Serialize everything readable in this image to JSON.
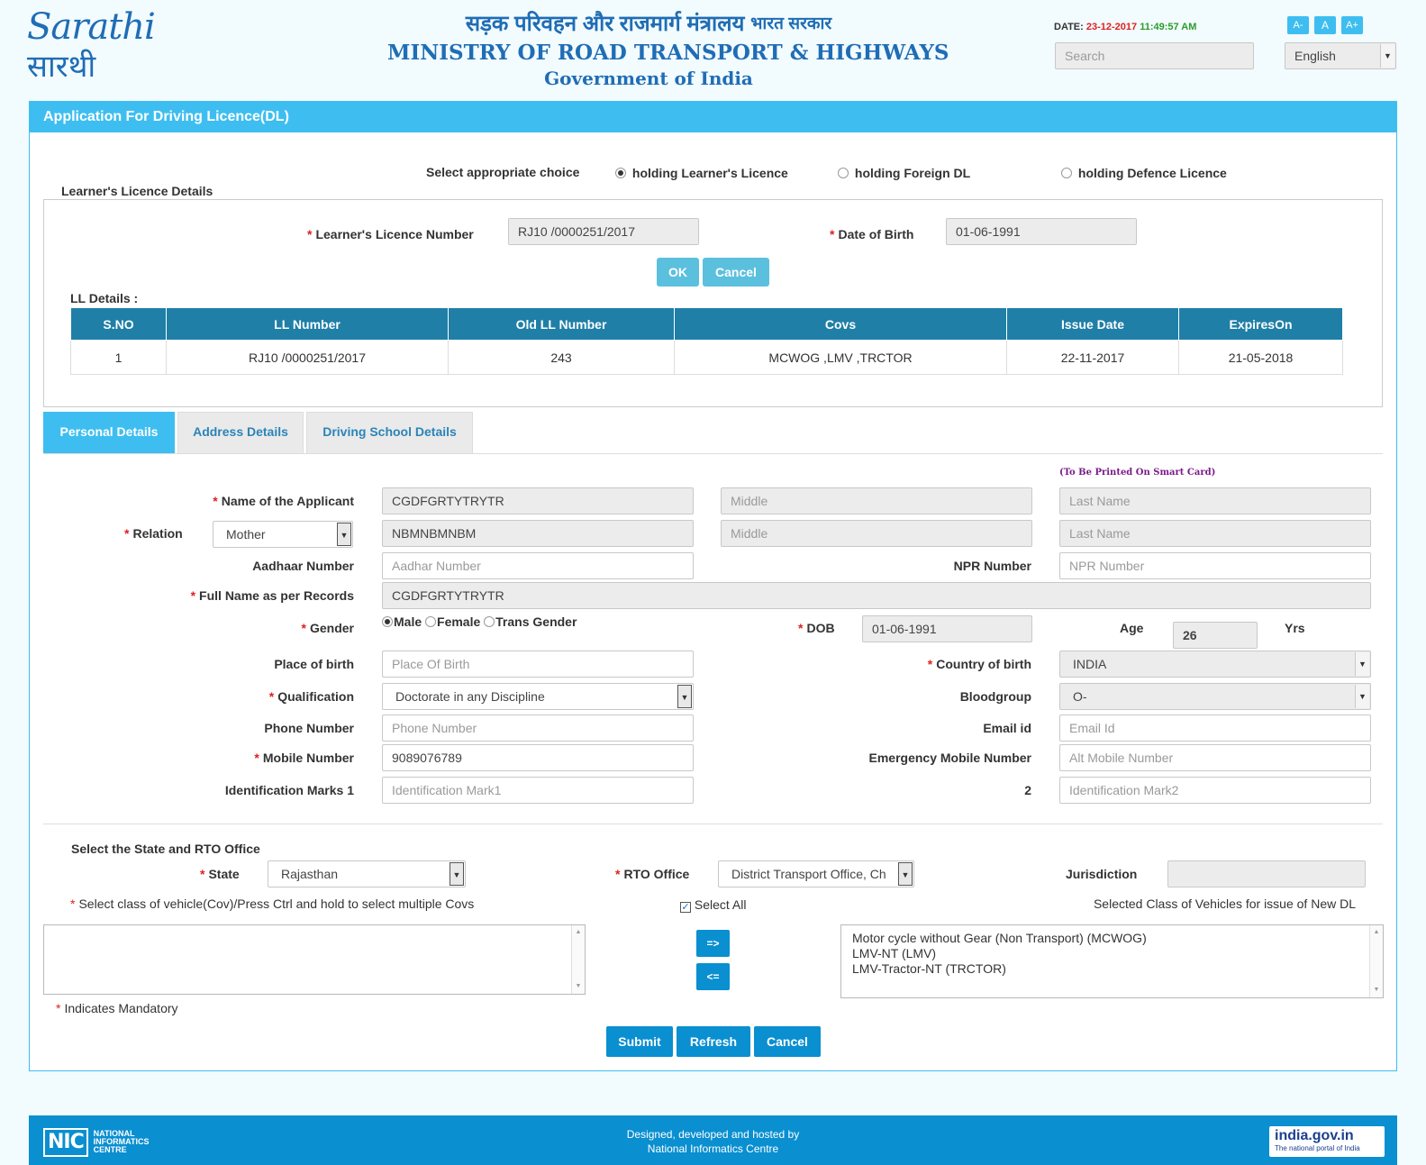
{
  "header": {
    "logo_en": "Sarathi",
    "logo_hi": "सारथी",
    "ministry_hindi": "सड़क परिवहन और राजमार्ग मंत्रालय",
    "gov_hindi": "भारत सरकार",
    "ministry": "MINISTRY OF ROAD TRANSPORT & HIGHWAYS",
    "government": "Government of India",
    "date_label": "DATE:",
    "date": "23-12-2017",
    "time": "11:49:57 AM",
    "font_small": "A-",
    "font_normal": "A",
    "font_large": "A+",
    "search_placeholder": "Search",
    "language": "English"
  },
  "panel": {
    "title": "Application For Driving Licence(DL)"
  },
  "choice": {
    "label": "Select appropriate choice",
    "options": [
      "holding Learner's Licence",
      "holding Foreign DL",
      "holding Defence Licence"
    ],
    "selected": "holding Learner's Licence"
  },
  "ll_section": {
    "legend": "Learner's Licence Details",
    "ll_number_label": "Learner's Licence Number",
    "ll_number": "RJ10 /0000251/2017",
    "dob_label": "Date of Birth",
    "dob": "01-06-1991",
    "ok": "OK",
    "cancel": "Cancel",
    "details_label": "LL Details :",
    "columns": [
      "S.NO",
      "LL Number",
      "Old LL Number",
      "Covs",
      "Issue Date",
      "ExpiresOn"
    ],
    "rows": [
      [
        "1",
        "RJ10 /0000251/2017",
        "243",
        "MCWOG ,LMV ,TRCTOR",
        "22-11-2017",
        "21-05-2018"
      ]
    ]
  },
  "tabs": [
    "Personal Details",
    "Address Details",
    "Driving School Details"
  ],
  "personal": {
    "smart_card_note": "(To Be Printed On Smart Card)",
    "name_label": "Name of the Applicant",
    "first_name": "CGDFGRTYTRYTR",
    "middle_ph": "Middle",
    "last_ph": "Last Name",
    "relation_label": "Relation",
    "relation": "Mother",
    "rel_first": "NBMNBMNBM",
    "aadhaar_label": "Aadhaar Number",
    "aadhaar_ph": "Aadhar Number",
    "npr_label": "NPR Number",
    "npr_ph": "NPR Number",
    "fullname_label": "Full Name as per Records",
    "fullname": "CGDFGRTYTRYTR",
    "gender_label": "Gender",
    "genders": [
      "Male",
      "Female",
      "Trans Gender"
    ],
    "gender_selected": "Male",
    "dob_label": "DOB",
    "dob": "01-06-1991",
    "age_label": "Age",
    "age": "26",
    "yrs": "Yrs",
    "pob_label": "Place of birth",
    "pob_ph": "Place Of Birth",
    "country_label": "Country of birth",
    "country": "INDIA",
    "qual_label": "Qualification",
    "qualification": "Doctorate in any Discipline",
    "blood_label": "Bloodgroup",
    "blood": "O-",
    "phone_label": "Phone Number",
    "phone_ph": "Phone Number",
    "email_label": "Email id",
    "email_ph": "Email Id",
    "mobile_label": "Mobile Number",
    "mobile": "9089076789",
    "emergency_label": "Emergency Mobile Number",
    "emergency_ph": "Alt Mobile Number",
    "idmark1_label": "Identification Marks 1",
    "idmark1_ph": "Identification Mark1",
    "idmark2_label": "2",
    "idmark2_ph": "Identification Mark2"
  },
  "rto": {
    "heading": "Select the State and RTO Office",
    "state_label": "State",
    "state": "Rajasthan",
    "rto_label": "RTO Office",
    "rto": "District Transport Office, Ch",
    "jurisdiction_label": "Jurisdiction",
    "cov_instruction": "Select class of vehicle(Cov)/Press Ctrl and hold to select multiple Covs",
    "select_all": "Select All",
    "selected_heading": "Selected Class of Vehicles for issue of New DL",
    "move_right": "=>",
    "move_left": "<=",
    "selected_covs": [
      "Motor cycle without Gear (Non Transport) (MCWOG)",
      "LMV-NT (LMV)",
      "LMV-Tractor-NT (TRCTOR)"
    ],
    "mandatory_note": "Indicates Mandatory"
  },
  "actions": {
    "submit": "Submit",
    "refresh": "Refresh",
    "cancel": "Cancel"
  },
  "footer": {
    "nic_short": "NIC",
    "nic_line1": "NATIONAL",
    "nic_line2": "INFORMATICS",
    "nic_line3": "CENTRE",
    "credit_line1": "Designed, developed and hosted by",
    "credit_line2": "National Informatics Centre",
    "india_gov": "india.gov.in",
    "india_gov_tag": "The national portal of India"
  },
  "colors": {
    "accent": "#3ebef0",
    "table_header": "#1f7fa7",
    "ministry_blue": "#1f6db5",
    "date_red": "#e02020",
    "time_green": "#2a9d2a",
    "footer": "#0a8fd0"
  }
}
